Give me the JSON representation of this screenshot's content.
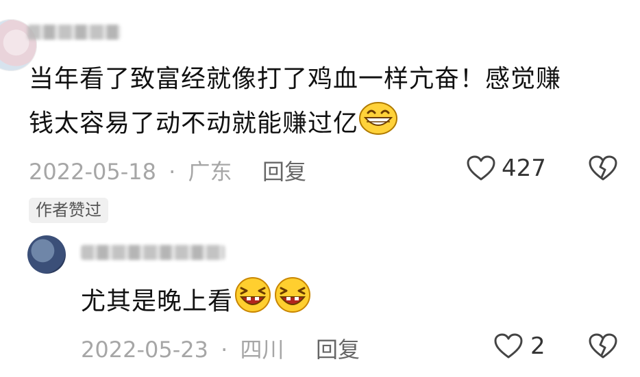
{
  "comment1": {
    "text_line1": "当年看了致富经就像打了鸡血一样亢奋！感觉赚",
    "text_line2": "钱太容易了动不动就能赚过亿",
    "date": "2022-05-18",
    "separator": "·",
    "location": "广东",
    "reply_label": "回复",
    "like_count": "427",
    "badge": "作者赞过",
    "emoji": "grinning-face"
  },
  "comment2": {
    "text": "尤其是晚上看",
    "date": "2022-05-23",
    "separator": "·",
    "location": "四川",
    "reply_label": "回复",
    "like_count": "2",
    "emoji": "laughing-face"
  },
  "icons": {
    "like": "heart-outline-icon",
    "dislike": "broken-heart-icon"
  },
  "colors": {
    "text": "#111111",
    "meta": "#a6a6a6",
    "emoji_fill": "#ffd23a"
  }
}
